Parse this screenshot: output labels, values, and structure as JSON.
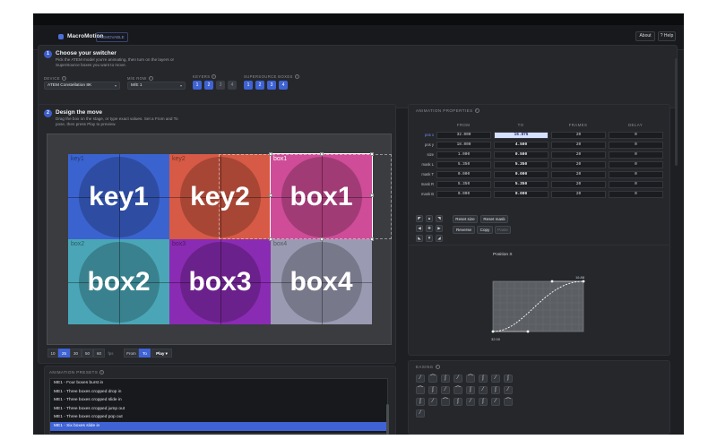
{
  "app": {
    "title": "MacroMotion",
    "badge": "REMOVABLE"
  },
  "header": {
    "about_label": "About",
    "help_label": "? Help"
  },
  "step1": {
    "number": "1",
    "title": "Choose your switcher",
    "desc_line1": "Pick the ATEM model you're animating, then turn on the layers or",
    "desc_line2": "SuperSource boxes you want to move.",
    "device_label": "DEVICE",
    "device_value": "ATEM Constellation 8K",
    "mix_label": "M/E ROW",
    "mix_value": "M/E 1",
    "keyers_label": "KEYERS",
    "keyers": [
      "1",
      "2",
      "3",
      "4"
    ],
    "ss_label": "SUPERSOURCE BOXES",
    "ss_boxes": [
      "1",
      "2",
      "3",
      "4"
    ]
  },
  "step2": {
    "number": "2",
    "title": "Design the move",
    "desc_line1": "Drag the box on the stage, or type exact values. Set a From and To",
    "desc_line2": "pose, then press Play to preview."
  },
  "stage": {
    "tiles": [
      {
        "corner": "key1",
        "label": "key1"
      },
      {
        "corner": "key2",
        "label": "key2"
      },
      {
        "corner": "box1",
        "label": "box1"
      },
      {
        "corner": "box2",
        "label": "box2"
      },
      {
        "corner": "box3",
        "label": "box3"
      },
      {
        "corner": "box4",
        "label": "box4"
      }
    ],
    "colors": {
      "key1": "#3b63d0",
      "key2": "#d65a45",
      "box1": "#cf4c98",
      "box2": "#4aa6b6",
      "box3": "#8a2bb3",
      "box4": "#9a9ab2"
    }
  },
  "zoom": {
    "options": [
      "10",
      "25",
      "30",
      "50",
      "60",
      "fps"
    ],
    "selected": "25"
  },
  "playback": {
    "from_label": "From",
    "to_label": "To",
    "play_label": "Play ▾"
  },
  "presets": {
    "section_label": "ANIMATION PRESETS",
    "items": [
      "ME1 - Four boxes burst in",
      "ME1 - Three boxes cropped drop in",
      "ME1 - Three boxes cropped slide in",
      "ME1 - Three boxes cropped jump out",
      "ME1 - Three boxes cropped pop out",
      "ME1 - Six boxes slide in"
    ],
    "selected_index": 5
  },
  "anim_props": {
    "section_label": "ANIMATION PROPERTIES",
    "columns": [
      "FROM",
      "TO",
      "FRAMES",
      "DELAY"
    ],
    "rows": [
      {
        "label": "pos x",
        "from": "32.000",
        "to": "16.875",
        "frames": "20",
        "delay": "0"
      },
      {
        "label": "pos y",
        "from": "18.000",
        "to": "4.500",
        "frames": "20",
        "delay": "0"
      },
      {
        "label": "size",
        "from": "1.000",
        "to": "0.500",
        "frames": "20",
        "delay": "0"
      },
      {
        "label": "mask L",
        "from": "5.350",
        "to": "5.350",
        "frames": "20",
        "delay": "0"
      },
      {
        "label": "mask T",
        "from": "0.000",
        "to": "0.000",
        "frames": "20",
        "delay": "0"
      },
      {
        "label": "mask R",
        "from": "5.350",
        "to": "5.350",
        "frames": "20",
        "delay": "0"
      },
      {
        "label": "mask B",
        "from": "0.000",
        "to": "0.000",
        "frames": "20",
        "delay": "0"
      }
    ],
    "buttons": {
      "reset_size": "Reset size",
      "reset_mask": "Reset mask",
      "reverse": "Reverse",
      "copy": "Copy",
      "paste": "Paste"
    }
  },
  "curve": {
    "title": "Position X",
    "start_value": "32.00",
    "end_value": "16.88"
  },
  "easing": {
    "section_label": "EASING"
  }
}
